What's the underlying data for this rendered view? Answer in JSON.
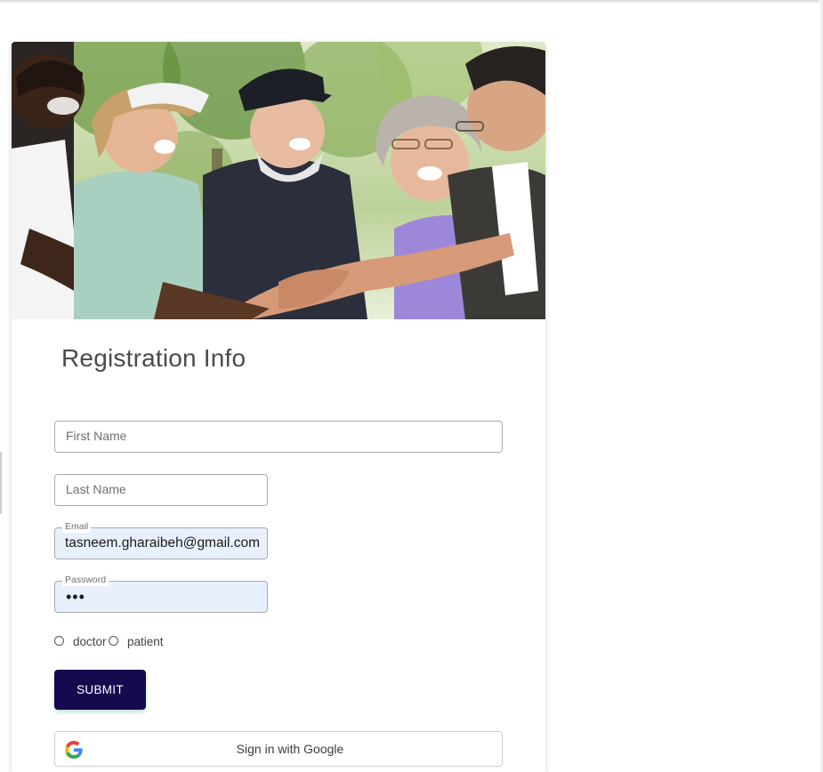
{
  "hero": {
    "alt": "group of smiling senior friends stacking hands"
  },
  "form": {
    "title": "Registration Info",
    "first_name": {
      "placeholder": "First Name",
      "value": ""
    },
    "last_name": {
      "placeholder": "Last Name",
      "value": ""
    },
    "email": {
      "label": "Email",
      "value": "tasneem.gharaibeh@gmail.com"
    },
    "password": {
      "label": "Password",
      "masked_value": "•••"
    },
    "role_options": [
      {
        "label": "doctor",
        "selected": false
      },
      {
        "label": "patient",
        "selected": false
      }
    ],
    "submit_label": "SUBMIT",
    "google_label": "Sign in with Google"
  },
  "colors": {
    "submit_bg": "#140a4d",
    "autofill_bg": "#e8f0fe",
    "title": "#4a4a4a"
  },
  "icons": {
    "google": "google-g-logo",
    "radio": "radio-circle"
  }
}
